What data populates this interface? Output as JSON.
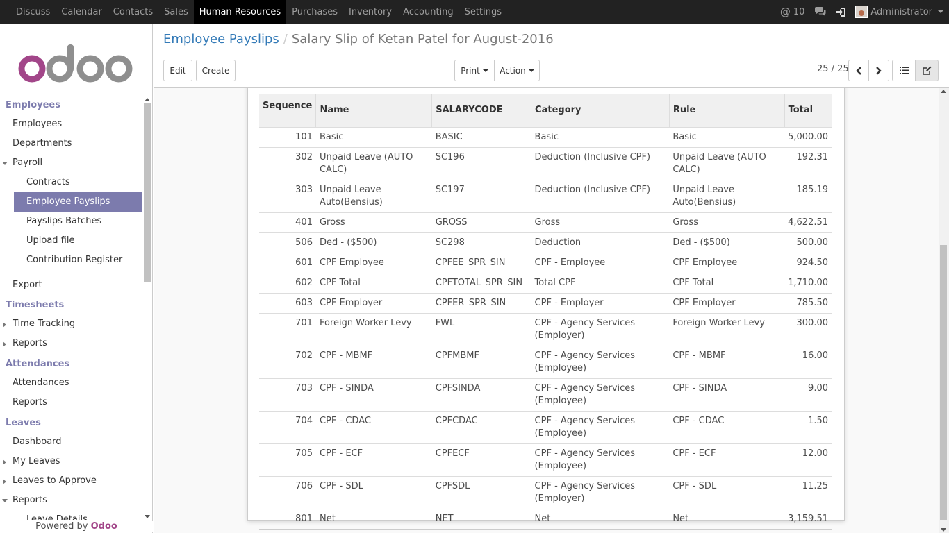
{
  "topbar": {
    "apps": [
      "Discuss",
      "Calendar",
      "Contacts",
      "Sales",
      "Human Resources",
      "Purchases",
      "Inventory",
      "Accounting",
      "Settings"
    ],
    "active_app": "Human Resources",
    "mentions_count": "10",
    "user_name": "Administrator"
  },
  "sidebar": {
    "logo_text": "odoo",
    "employees_header": "Employees",
    "employees": "Employees",
    "departments": "Departments",
    "payroll": "Payroll",
    "contracts": "Contracts",
    "employee_payslips": "Employee Payslips",
    "payslip_batches": "Payslips Batches",
    "upload_file": "Upload file",
    "contribution_register": "Contribution Register",
    "export": "Export",
    "timesheets_header": "Timesheets",
    "time_tracking": "Time Tracking",
    "ts_reports": "Reports",
    "attendances_header": "Attendances",
    "attendances": "Attendances",
    "att_reports": "Reports",
    "leaves_header": "Leaves",
    "dashboard": "Dashboard",
    "my_leaves": "My Leaves",
    "leaves_to_approve": "Leaves to Approve",
    "lv_reports": "Reports",
    "leave_details": "Leave Details",
    "powered_by": "Powered by",
    "powered_brand": "Odoo"
  },
  "control_panel": {
    "breadcrumb_parent": "Employee Payslips",
    "breadcrumb_separator": "/",
    "breadcrumb_current": "Salary Slip of Ketan Patel for August-2016",
    "edit_label": "Edit",
    "create_label": "Create",
    "print_label": "Print",
    "action_label": "Action",
    "pager": "25 / 25"
  },
  "table": {
    "headers": {
      "sequence": "Sequence",
      "name": "Name",
      "code": "SALARYCODE",
      "category": "Category",
      "rule": "Rule",
      "total": "Total"
    },
    "rows": [
      {
        "seq": "101",
        "name": "Basic",
        "code": "BASIC",
        "category": "Basic",
        "rule": "Basic",
        "total": "5,000.00"
      },
      {
        "seq": "302",
        "name": "Unpaid Leave (AUTO CALC)",
        "code": "SC196",
        "category": "Deduction (Inclusive CPF)",
        "rule": "Unpaid Leave (AUTO CALC)",
        "total": "192.31"
      },
      {
        "seq": "303",
        "name": "Unpaid Leave Auto(Bensius)",
        "code": "SC197",
        "category": "Deduction (Inclusive CPF)",
        "rule": "Unpaid Leave Auto(Bensius)",
        "total": "185.19"
      },
      {
        "seq": "401",
        "name": "Gross",
        "code": "GROSS",
        "category": "Gross",
        "rule": "Gross",
        "total": "4,622.51"
      },
      {
        "seq": "506",
        "name": "Ded - ($500)",
        "code": "SC298",
        "category": "Deduction",
        "rule": "Ded - ($500)",
        "total": "500.00"
      },
      {
        "seq": "601",
        "name": "CPF Employee",
        "code": "CPFEE_SPR_SIN",
        "category": "CPF - Employee",
        "rule": "CPF Employee",
        "total": "924.50"
      },
      {
        "seq": "602",
        "name": "CPF Total",
        "code": "CPFTOTAL_SPR_SIN",
        "category": "Total CPF",
        "rule": "CPF Total",
        "total": "1,710.00"
      },
      {
        "seq": "603",
        "name": "CPF Employer",
        "code": "CPFER_SPR_SIN",
        "category": "CPF - Employer",
        "rule": "CPF Employer",
        "total": "785.50"
      },
      {
        "seq": "701",
        "name": "Foreign Worker Levy",
        "code": "FWL",
        "category": "CPF - Agency Services (Employer)",
        "rule": "Foreign Worker Levy",
        "total": "300.00"
      },
      {
        "seq": "702",
        "name": "CPF - MBMF",
        "code": "CPFMBMF",
        "category": "CPF - Agency Services (Employee)",
        "rule": "CPF - MBMF",
        "total": "16.00"
      },
      {
        "seq": "703",
        "name": "CPF - SINDA",
        "code": "CPFSINDA",
        "category": "CPF - Agency Services (Employee)",
        "rule": "CPF - SINDA",
        "total": "9.00"
      },
      {
        "seq": "704",
        "name": "CPF - CDAC",
        "code": "CPFCDAC",
        "category": "CPF - Agency Services (Employee)",
        "rule": "CPF - CDAC",
        "total": "1.50"
      },
      {
        "seq": "705",
        "name": "CPF - ECF",
        "code": "CPFECF",
        "category": "CPF - Agency Services (Employee)",
        "rule": "CPF - ECF",
        "total": "12.00"
      },
      {
        "seq": "706",
        "name": "CPF - SDL",
        "code": "CPFSDL",
        "category": "CPF - Agency Services (Employer)",
        "rule": "CPF - SDL",
        "total": "11.25"
      },
      {
        "seq": "801",
        "name": "Net",
        "code": "NET",
        "category": "Net",
        "rule": "Net",
        "total": "3,159.51"
      }
    ]
  },
  "colors": {
    "brand": "#7c7bad",
    "topbar": "#222222",
    "link": "#337ab7"
  }
}
